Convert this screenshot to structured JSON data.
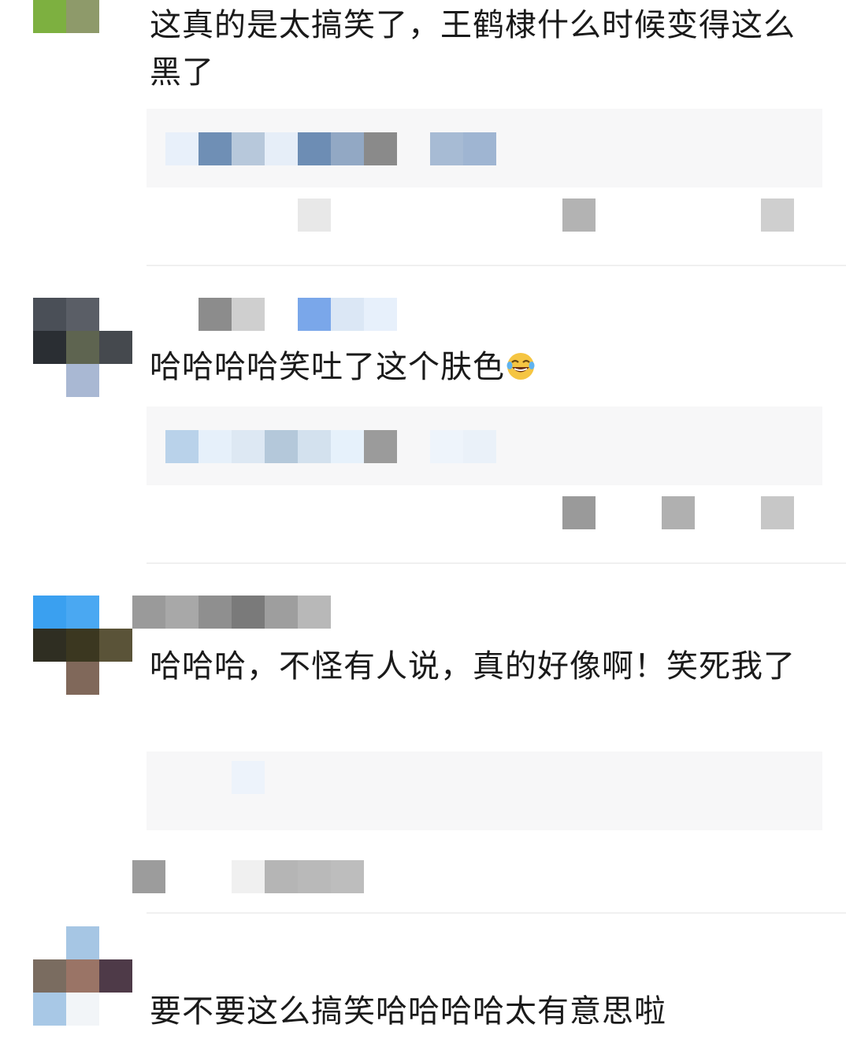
{
  "comments": [
    {
      "text": "这真的是太搞笑了，王鹤棣什么时候变得这么黑了",
      "emoji": ""
    },
    {
      "text": "哈哈哈哈笑吐了这个肤色",
      "emoji": "laugh-cry-icon"
    },
    {
      "text": "哈哈哈，不怪有人说，真的好像啊！笑死我了",
      "emoji": ""
    },
    {
      "text": "要不要这么搞笑哈哈哈哈太有意思啦",
      "emoji": ""
    }
  ],
  "colors": {
    "text": "#1a1a1a",
    "reply_bg": "#f7f7f8",
    "divider": "#f0f0f0"
  }
}
